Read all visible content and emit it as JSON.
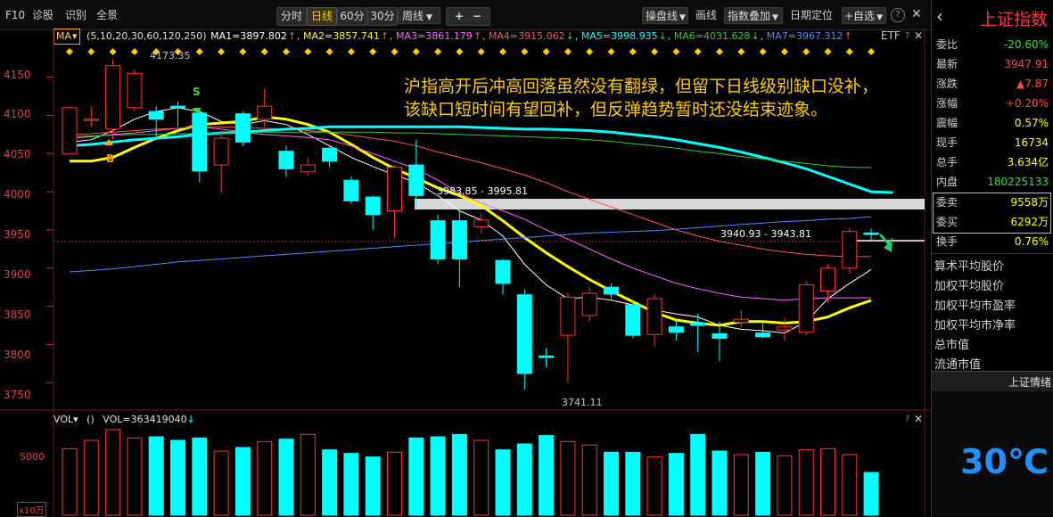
{
  "toolbar": {
    "left": [
      "F10",
      "诊股",
      "识别",
      "全景"
    ],
    "periods": [
      "分时",
      "日线",
      "60分",
      "30分"
    ],
    "active_period": "日线",
    "week_dropdown": "周线",
    "plus": "+",
    "minus": "−",
    "right": [
      "操盘线",
      "画线",
      "指数叠加",
      "日期定位",
      "+自选"
    ],
    "help": "?",
    "close": "✕"
  },
  "ma_bar": {
    "label": "MA",
    "params": "(5,10,20,30,60,120,250)",
    "ma1": "MA1=3897.802",
    "ma2": "MA2=3857.741",
    "ma3": "MA3=3861.179",
    "ma4": "MA4=3915.062",
    "ma5": "MA5=3998.935",
    "ma6": "MA6=4031.628",
    "ma7": "MA7=3967.312",
    "etf": "ETF",
    "colors": {
      "ma1": "#ffffff",
      "ma2": "#ffff00",
      "ma3": "#ff66ff",
      "ma4": "#ff5555",
      "ma5": "#00ffff",
      "ma6": "#33cc33",
      "ma7": "#5588ff"
    }
  },
  "annotation": {
    "line1": "沪指高开后冲高回落虽然没有翻绿，但留下日线级别缺口没补，",
    "line2": "该缺口短时间有望回补，但反弹趋势暂时还没结束迹象。"
  },
  "markers": {
    "high_label": "4173.35",
    "low_label": "3741.11",
    "gap1": "3983.85 - 3995.81",
    "gap2": "3940.93 - 3943.81",
    "buy": "B",
    "sell": "S"
  },
  "price_axis": [
    "4150",
    "4100",
    "4050",
    "4000",
    "3950",
    "3900",
    "3850",
    "3800",
    "3750"
  ],
  "volume_bar": {
    "label": "VOL",
    "paren": "()",
    "value": "VOL=363419040",
    "arrow": "↓",
    "axis": "5000",
    "unit": "x10万"
  },
  "right_panel": {
    "title": "上证指数",
    "rows": [
      {
        "label": "委比",
        "value": "-20.60%",
        "color": "#33dd33"
      },
      {
        "label": "最新",
        "value": "3947.91",
        "color": "#ff4444"
      },
      {
        "label": "涨跌",
        "value": "▲7.87",
        "color": "#ff4444"
      },
      {
        "label": "涨幅",
        "value": "+0.20%",
        "color": "#ff4444"
      },
      {
        "label": "震幅",
        "value": "0.57%",
        "color": "#ffff00"
      },
      {
        "label": "现手",
        "value": "16734",
        "color": "#ffff00"
      },
      {
        "label": "总手",
        "value": "3.634亿",
        "color": "#ffff00"
      },
      {
        "label": "内盘",
        "value": "180225133",
        "color": "#33dd33"
      },
      {
        "label": "委卖",
        "value": "9558万",
        "color": "#ffff00"
      },
      {
        "label": "委买",
        "value": "6292万",
        "color": "#ffff00"
      },
      {
        "label": "换手",
        "value": "0.76%",
        "color": "#ffff00"
      }
    ],
    "items": [
      "算术平均股价",
      "加权平均股价",
      "加权平均市盈率",
      "加权平均市净率",
      "总市值",
      "流通市值"
    ],
    "footer_tab": "上证情绪",
    "temperature": "30℃"
  },
  "chart_data": {
    "type": "candlestick",
    "y_range": [
      3720,
      4195
    ],
    "ohlc": [
      [
        4050,
        4110,
        4050,
        4112
      ],
      [
        4095,
        4095,
        4085,
        4112
      ],
      [
        4082,
        4165,
        4068,
        4173.35
      ],
      [
        4110,
        4155,
        4105,
        4160
      ],
      [
        4105,
        4095,
        4072,
        4112
      ],
      [
        4112,
        4110,
        4085,
        4118
      ],
      [
        4103,
        4027,
        4012,
        4108
      ],
      [
        4035,
        4070,
        3998,
        4080
      ],
      [
        4102,
        4065,
        4060,
        4105
      ],
      [
        4095,
        4112,
        4085,
        4135
      ],
      [
        4053,
        4030,
        4020,
        4060
      ],
      [
        4026,
        4035,
        4021,
        4045
      ],
      [
        4057,
        4040,
        4032,
        4060
      ],
      [
        4015,
        3988,
        3984,
        4020
      ],
      [
        3993,
        3970,
        3950,
        3995
      ],
      [
        3975,
        4032,
        3940,
        4035
      ],
      [
        4035,
        3995,
        3980,
        4068
      ],
      [
        3962,
        3912,
        3905,
        3970
      ],
      [
        3962,
        3912,
        3875,
        3980
      ],
      [
        3954,
        3963,
        3945,
        3972
      ],
      [
        3910,
        3880,
        3865,
        3912
      ],
      [
        3865,
        3762,
        3741.11,
        3872
      ],
      [
        3785,
        3783,
        3770,
        3795
      ],
      [
        3812,
        3862,
        3750,
        3868
      ],
      [
        3838,
        3867,
        3830,
        3875
      ],
      [
        3875,
        3866,
        3860,
        3880
      ],
      [
        3852,
        3812,
        3808,
        3858
      ],
      [
        3813,
        3860,
        3798,
        3865
      ],
      [
        3823,
        3816,
        3805,
        3832
      ],
      [
        3828,
        3825,
        3790,
        3840
      ],
      [
        3814,
        3808,
        3778,
        3830
      ],
      [
        3829,
        3833,
        3822,
        3845
      ],
      [
        3815,
        3810,
        3808,
        3832
      ],
      [
        3819,
        3823,
        3805,
        3835
      ],
      [
        3816,
        3878,
        3812,
        3883
      ],
      [
        3870,
        3900,
        3855,
        3905
      ],
      [
        3900,
        3947.91,
        3893,
        3953
      ],
      [
        3946,
        3944,
        3936,
        3952
      ]
    ],
    "ma_series": [
      {
        "name": "MA1",
        "color": "#ffffff",
        "values": [
          4065,
          4068,
          4080,
          4095,
          4105,
          4110,
          4105,
          4092,
          4088,
          4093,
          4088,
          4075,
          4060,
          4045,
          4033,
          4022,
          4012,
          3995,
          3975,
          3963,
          3942,
          3905,
          3878,
          3860,
          3862,
          3858,
          3852,
          3845,
          3840,
          3836,
          3825,
          3820,
          3818,
          3815,
          3830,
          3860,
          3880,
          3898
        ]
      },
      {
        "name": "MA2",
        "color": "#ffff00",
        "values": [
          4040,
          4040,
          4045,
          4058,
          4070,
          4080,
          4088,
          4090,
          4092,
          4098,
          4095,
          4088,
          4078,
          4062,
          4045,
          4030,
          4018,
          4005,
          3995,
          3982,
          3962,
          3940,
          3920,
          3902,
          3885,
          3870,
          3856,
          3842,
          3832,
          3828,
          3825,
          3830,
          3830,
          3828,
          3830,
          3836,
          3848,
          3857.7
        ]
      },
      {
        "name": "MA3",
        "color": "#ff66ff",
        "values": [
          4070,
          4072,
          4075,
          4077,
          4080,
          4083,
          4085,
          4082,
          4078,
          4075,
          4073,
          4071,
          4068,
          4060,
          4050,
          4040,
          4030,
          4015,
          3998,
          3985,
          3975,
          3964,
          3950,
          3938,
          3925,
          3912,
          3900,
          3890,
          3880,
          3873,
          3867,
          3862,
          3860,
          3858,
          3860,
          3861,
          3861,
          3861.2
        ]
      },
      {
        "name": "MA4",
        "color": "#ff5555",
        "values": [
          4075,
          4076,
          4078,
          4080,
          4082,
          4083,
          4085,
          4085,
          4084,
          4083,
          4082,
          4080,
          4078,
          4074,
          4070,
          4066,
          4060,
          4052,
          4045,
          4038,
          4030,
          4022,
          4012,
          4000,
          3990,
          3980,
          3970,
          3960,
          3950,
          3942,
          3935,
          3930,
          3925,
          3921,
          3918,
          3916,
          3915,
          3915.1
        ]
      },
      {
        "name": "MA5",
        "color": "#00ffff",
        "values": [
          4060,
          4062,
          4065,
          4068,
          4070,
          4072,
          4075,
          4077,
          4078,
          4080,
          4082,
          4083,
          4085,
          4085,
          4085,
          4085,
          4085,
          4085,
          4085,
          4084,
          4083,
          4082,
          4082,
          4081,
          4080,
          4078,
          4075,
          4072,
          4068,
          4063,
          4058,
          4052,
          4045,
          4038,
          4030,
          4020,
          4010,
          4000,
          3999
        ]
      },
      {
        "name": "MA6",
        "color": "#33cc33",
        "values": [
          4072,
          4073,
          4074,
          4075,
          4075,
          4076,
          4076,
          4077,
          4077,
          4078,
          4078,
          4078,
          4078,
          4078,
          4078,
          4077,
          4077,
          4076,
          4075,
          4074,
          4073,
          4072,
          4071,
          4070,
          4068,
          4066,
          4063,
          4060,
          4057,
          4053,
          4050,
          4046,
          4043,
          4040,
          4037,
          4034,
          4032,
          4031.6
        ]
      },
      {
        "name": "MA7",
        "color": "#5588ff",
        "values": [
          3895,
          3897,
          3899,
          3902,
          3905,
          3908,
          3910,
          3912,
          3914,
          3916,
          3918,
          3920,
          3922,
          3924,
          3926,
          3928,
          3930,
          3932,
          3934,
          3936,
          3938,
          3940,
          3942,
          3944,
          3946,
          3947,
          3948,
          3949,
          3951,
          3953,
          3955,
          3957,
          3959,
          3961,
          3962,
          3964,
          3965,
          3967.3
        ]
      }
    ],
    "volume": [
      5600,
      6300,
      7200,
      6500,
      6600,
      6300,
      6500,
      5400,
      5700,
      6200,
      6400,
      6800,
      5500,
      5200,
      4900,
      5300,
      6500,
      6600,
      6800,
      6300,
      5500,
      6000,
      6700,
      6200,
      5900,
      5300,
      5300,
      4900,
      5200,
      6800,
      5400,
      5100,
      5300,
      5000,
      5500,
      5600,
      5100,
      3600
    ],
    "volume_max": 7500
  }
}
